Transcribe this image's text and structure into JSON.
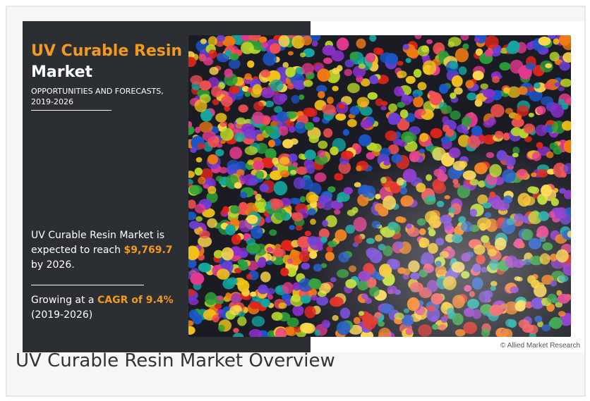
{
  "infographic": {
    "title_accent": "UV Curable Resin",
    "title_main": "Market",
    "subtitle": "OPPORTUNITIES AND FORECASTS, 2019-2026",
    "stat1": {
      "line_a": "UV Curable Resin Market is expected to reach ",
      "value": "$9,769.7",
      "line_b": " by 2026."
    },
    "stat2": {
      "line_a": "Growing at a ",
      "cagr": "CAGR of 9.4%",
      "line_b": " (2019-2026)"
    },
    "credit": "© Allied Market Research",
    "image_subject": "colorful-resin-pellets-photo"
  },
  "caption": "UV Curable Resin Market Overview",
  "colors": {
    "accent": "#f39a1e",
    "panel": "#2b2f33"
  }
}
